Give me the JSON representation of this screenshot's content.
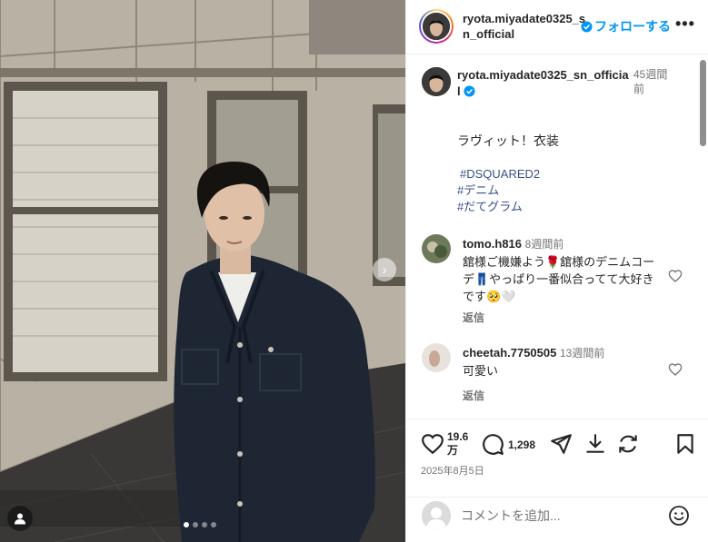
{
  "post": {
    "username": "ryota.miyadate0325_sn_official",
    "follow_label": "フォローする",
    "more_label": "•••",
    "caption_time": "45週間前",
    "caption_text": "ラヴィット！衣装",
    "hashtags": [
      "#DSQUARED2",
      "#デニム",
      "#だてグラム"
    ],
    "likes": "19.6万",
    "comments_count": "1,298",
    "date": "2025年8月5日"
  },
  "comments": [
    {
      "user": "tomo.h816",
      "time": "8週間前",
      "text": "舘様ご機嫌よう🌹舘様のデニムコーデ👖やっぱり一番似合ってて大好きです🥺🤍",
      "reply_label": "返信"
    },
    {
      "user": "cheetah.7750505",
      "time": "13週間前",
      "text": "可愛い",
      "reply_label": "返信"
    }
  ],
  "composer": {
    "placeholder": "コメントを追加..."
  },
  "carousel": {
    "count": 4,
    "active_index": 0
  },
  "colors": {
    "link": "#385185",
    "follow": "#0095f6",
    "verified": "#0095f6"
  }
}
